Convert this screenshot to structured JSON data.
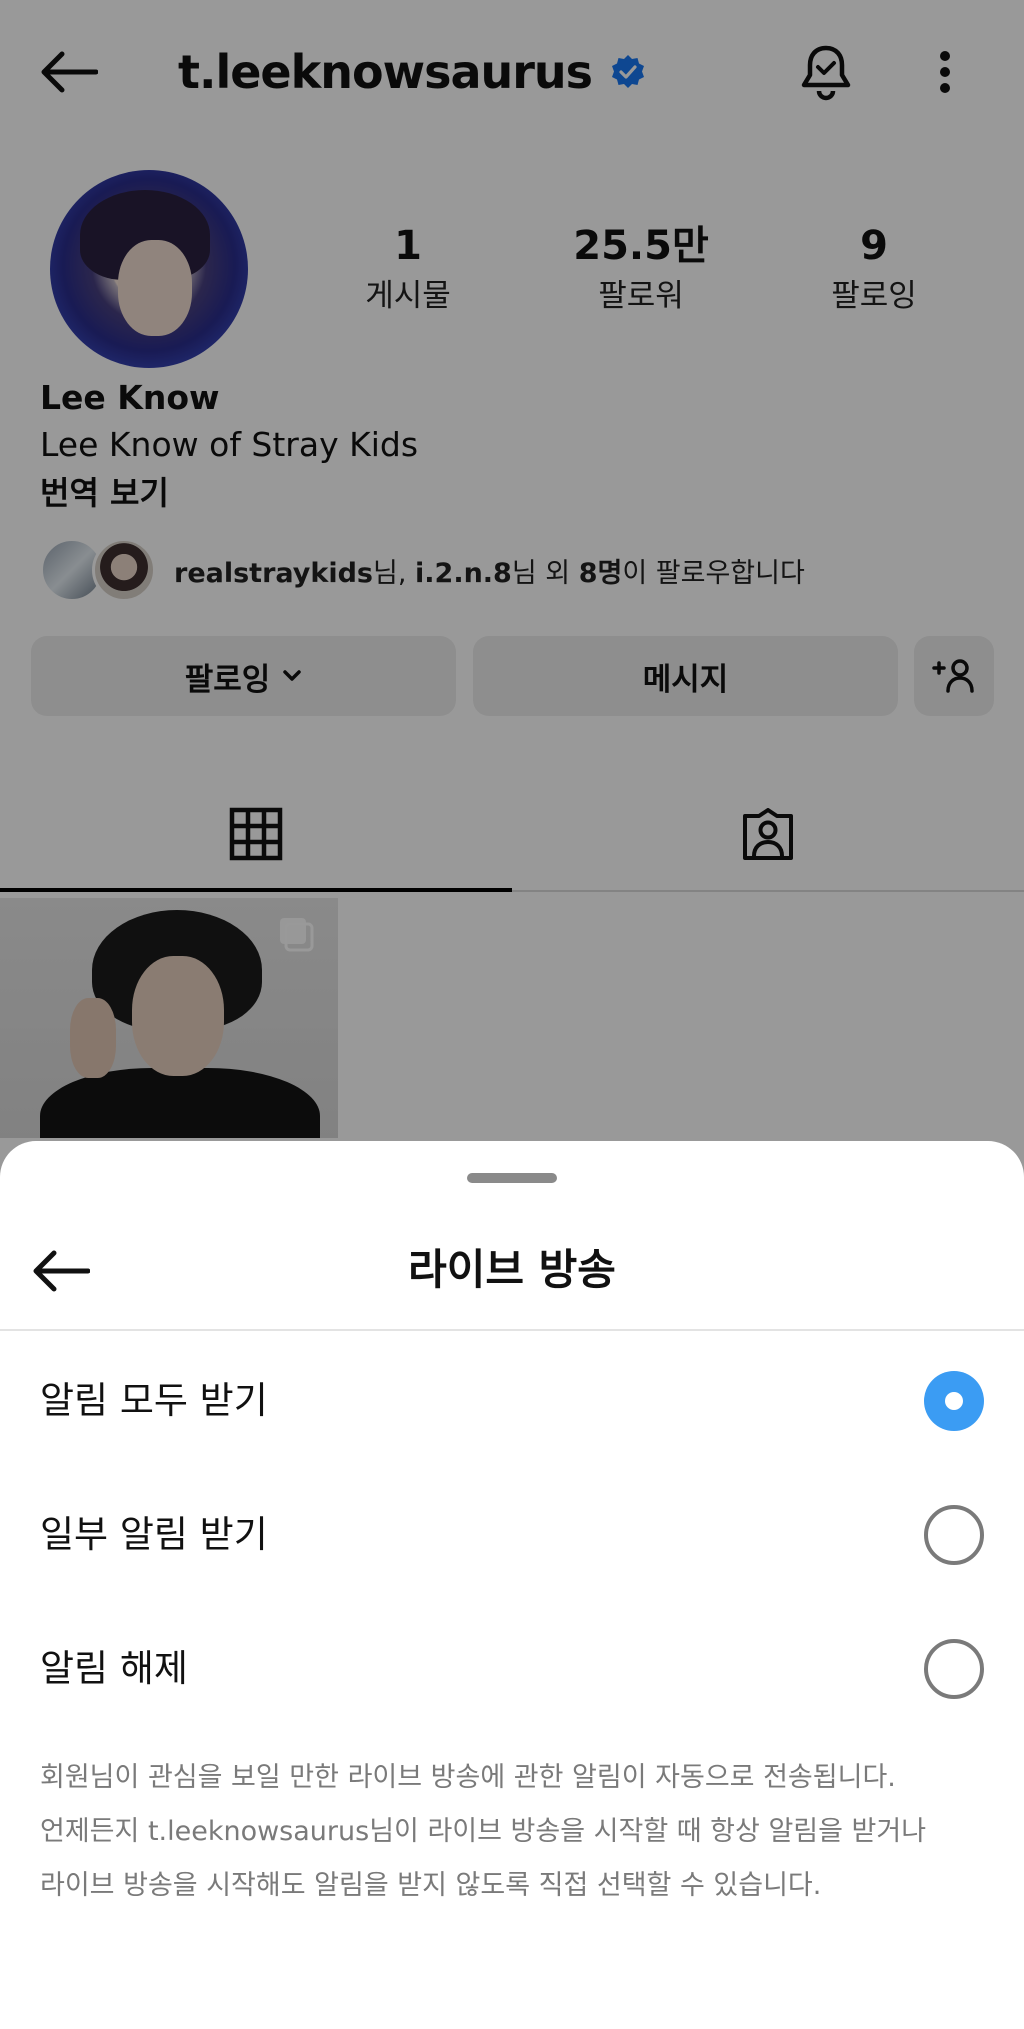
{
  "profile": {
    "username": "t.leeknowsaurus",
    "display_name": "Lee Know",
    "bio": "Lee Know of Stray Kids",
    "translate_label": "번역 보기",
    "stats": {
      "posts_value": "1",
      "posts_label": "게시물",
      "followers_value": "25.5만",
      "followers_label": "팔로워",
      "following_value": "9",
      "following_label": "팔로잉"
    },
    "followed_by": {
      "user1": "realstraykids",
      "suffix1": "님, ",
      "user2": "i.2.n.8",
      "middle": "님 외 ",
      "count": "8명",
      "end": "이 팔로우합니다"
    },
    "buttons": {
      "following": "팔로잉",
      "message": "메시지"
    },
    "icons": {
      "back": "arrow-left-icon",
      "verified": "verified-badge-icon",
      "bell": "notification-bell-icon",
      "more": "more-vertical-icon",
      "add_person": "add-person-icon",
      "grid": "grid-icon",
      "tagged": "tagged-person-icon",
      "multi": "carousel-icon"
    },
    "verified_color": "#1877F2"
  },
  "sheet": {
    "title": "라이브 방송",
    "options": [
      {
        "label": "알림 모두 받기",
        "selected": true
      },
      {
        "label": "일부 알림 받기",
        "selected": false
      },
      {
        "label": "알림 해제",
        "selected": false
      }
    ],
    "description_lines": [
      "회원님이 관심을 보일 만한 라이브 방송에 관한 알림이 자동으로 전송됩니다.",
      "언제든지 t.leeknowsaurus님이 라이브 방송을 시작할 때 항상 알림을 받거나",
      "라이브 방송을 시작해도 알림을 받지 않도록 직접 선택할 수 있습니다."
    ],
    "accent_color": "#3B9CF3"
  }
}
